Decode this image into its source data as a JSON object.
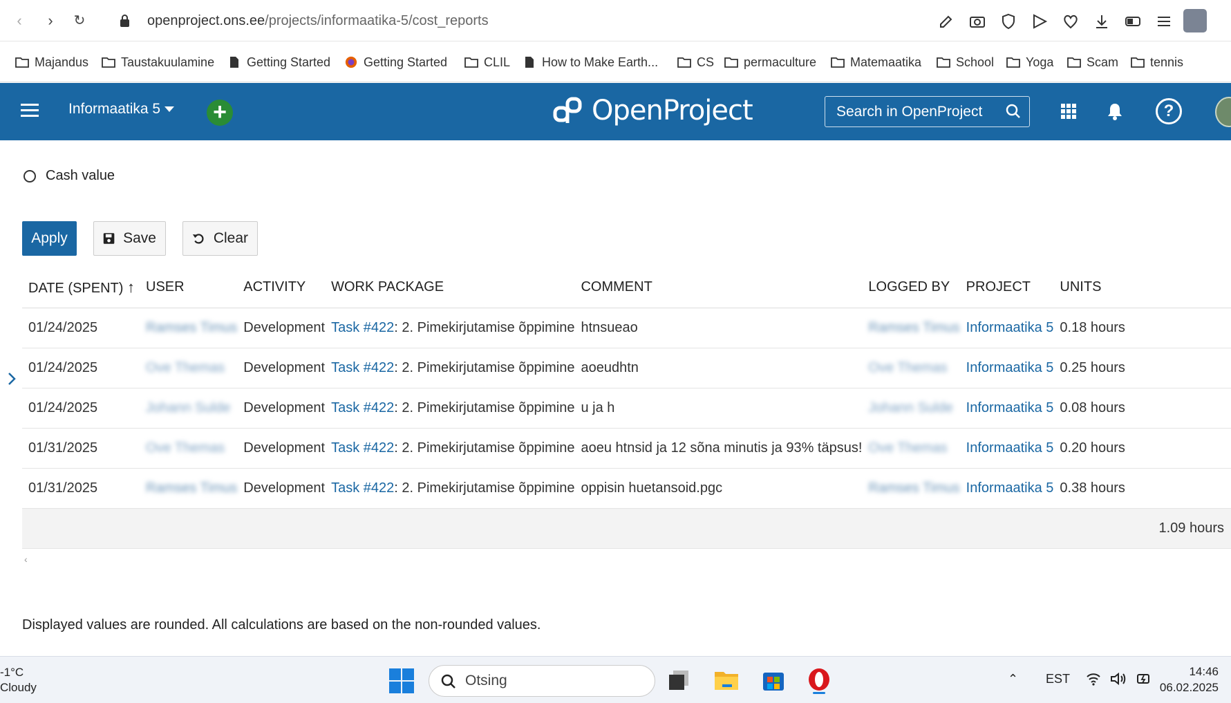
{
  "browser": {
    "url_host": "openproject.ons.ee",
    "url_path": "/projects/informaatika-5/cost_reports"
  },
  "bookmarks": [
    {
      "label": "Majandus",
      "icon": "folder-icon"
    },
    {
      "label": "Taustakuulamine",
      "icon": "folder-icon"
    },
    {
      "label": "Getting Started",
      "icon": "document-icon"
    },
    {
      "label": "Getting Started",
      "icon": "firefox-icon"
    },
    {
      "label": "CLIL",
      "icon": "folder-icon"
    },
    {
      "label": "How to Make Earth...",
      "icon": "document-icon"
    },
    {
      "label": "CS",
      "icon": "folder-icon"
    },
    {
      "label": "permaculture",
      "icon": "folder-icon"
    },
    {
      "label": "Matemaatika",
      "icon": "folder-icon"
    },
    {
      "label": "School",
      "icon": "folder-icon"
    },
    {
      "label": "Yoga",
      "icon": "folder-icon"
    },
    {
      "label": "Scam",
      "icon": "folder-icon"
    },
    {
      "label": "tennis",
      "icon": "folder-icon"
    }
  ],
  "header": {
    "project_name": "Informaatika 5",
    "logo_text": "OpenProject",
    "search_placeholder": "Search in OpenProject",
    "help_label": "?",
    "brand_color": "#1a67a3"
  },
  "options": {
    "cash_value_label": "Cash value"
  },
  "buttons": {
    "apply": "Apply",
    "save": "Save",
    "clear": "Clear"
  },
  "table": {
    "columns": [
      "DATE (SPENT)",
      "USER",
      "ACTIVITY",
      "WORK PACKAGE",
      "COMMENT",
      "LOGGED BY",
      "PROJECT",
      "UNITS"
    ],
    "rows": [
      {
        "date": "01/24/2025",
        "user": "Ramses Timus",
        "activity": "Development",
        "wp_link": "Task #422",
        "wp_title": ": 2. Pimekirjutamise õppimine",
        "comment": "htnsueao",
        "logged_by": "Ramses Timus",
        "project": "Informaatika 5",
        "units": "0.18 hours"
      },
      {
        "date": "01/24/2025",
        "user": "Ove Themas",
        "activity": "Development",
        "wp_link": "Task #422",
        "wp_title": ": 2. Pimekirjutamise õppimine",
        "comment": "aoeudhtn",
        "logged_by": "Ove Themas",
        "project": "Informaatika 5",
        "units": "0.25 hours"
      },
      {
        "date": "01/24/2025",
        "user": "Johann Sulde",
        "activity": "Development",
        "wp_link": "Task #422",
        "wp_title": ": 2. Pimekirjutamise õppimine",
        "comment": "u ja h",
        "logged_by": "Johann Sulde",
        "project": "Informaatika 5",
        "units": "0.08 hours"
      },
      {
        "date": "01/31/2025",
        "user": "Ove Themas",
        "activity": "Development",
        "wp_link": "Task #422",
        "wp_title": ": 2. Pimekirjutamise õppimine",
        "comment": "aoeu htnsid ja 12 sõna minutis ja 93% täpsus!",
        "logged_by": "Ove Themas",
        "project": "Informaatika 5",
        "units": "0.20 hours"
      },
      {
        "date": "01/31/2025",
        "user": "Ramses Timus",
        "activity": "Development",
        "wp_link": "Task #422",
        "wp_title": ": 2. Pimekirjutamise õppimine",
        "comment": "oppisin huetansoid.pgc",
        "logged_by": "Ramses Timus",
        "project": "Informaatika 5",
        "units": "0.38 hours"
      }
    ],
    "total": "1.09 hours"
  },
  "scroll_hint": "‹",
  "footnote": "Displayed values are rounded. All calculations are based on the non-rounded values.",
  "taskbar": {
    "temperature": "-1°C",
    "weather": "Cloudy",
    "search_placeholder": "Otsing",
    "language": "EST",
    "time": "14:46",
    "date": "06.02.2025"
  }
}
